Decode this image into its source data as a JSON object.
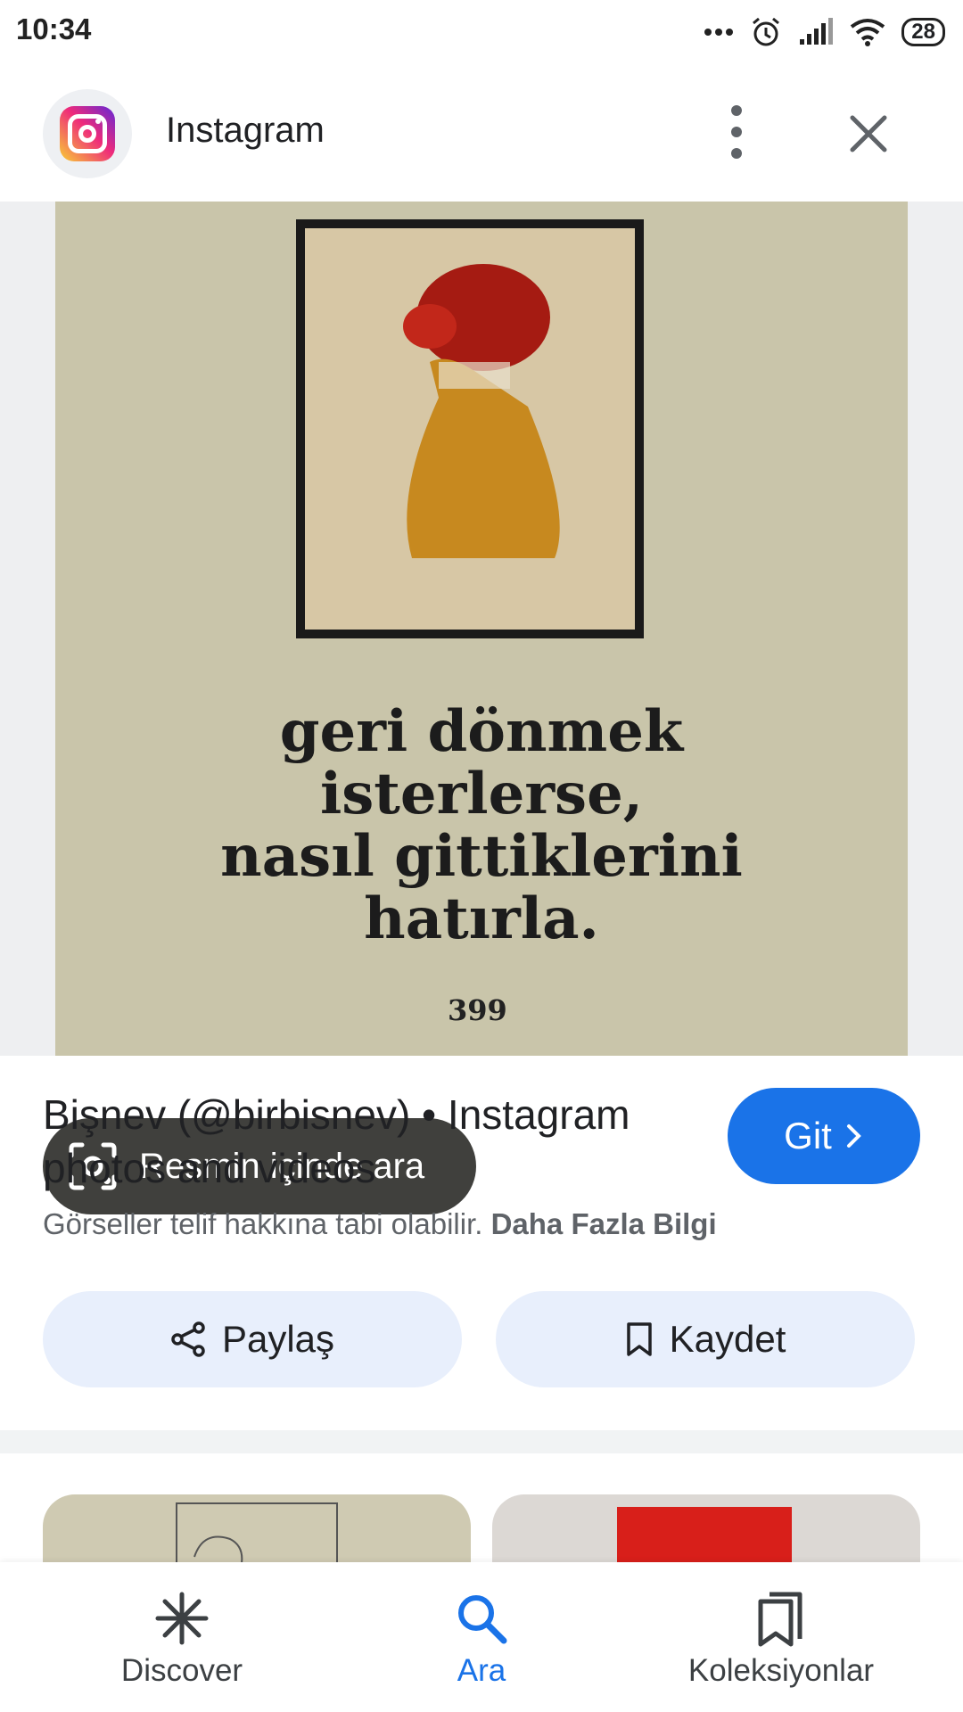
{
  "status_bar": {
    "time": "10:34",
    "battery": "28"
  },
  "app_bar": {
    "title": "Instagram"
  },
  "image": {
    "poster_lines": [
      "geri dönmek",
      "isterlerse,",
      "nasıl gittiklerini",
      "hatırla."
    ],
    "page_number": "399",
    "lens_chip_label": "Resmin içinde ara"
  },
  "result": {
    "title": "Bişnev (@birbisnev) • Instagram photos and videos",
    "visit_label": "Git",
    "copyright_text": "Görseller telif hakkına tabi olabilir.",
    "more_info_link": "Daha Fazla Bilgi"
  },
  "actions": {
    "share_label": "Paylaş",
    "save_label": "Kaydet"
  },
  "bottom_nav": {
    "items": [
      {
        "label": "Discover",
        "icon": "asterisk-icon"
      },
      {
        "label": "Ara",
        "icon": "search-icon",
        "active": true
      },
      {
        "label": "Koleksiyonlar",
        "icon": "collections-icon"
      }
    ]
  },
  "colors": {
    "accent": "#1a73e8",
    "chip_bg": "#e8effc"
  }
}
